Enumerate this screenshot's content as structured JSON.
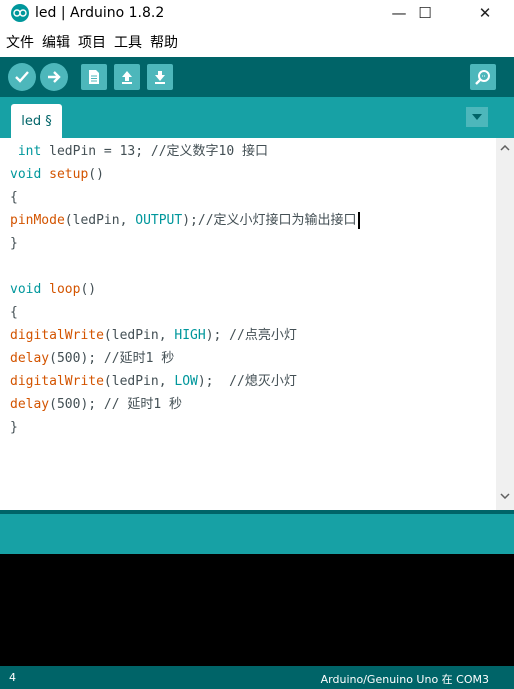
{
  "window": {
    "title": "led | Arduino 1.8.2",
    "minimize_symbol": "—",
    "maximize_symbol": "☐",
    "close_symbol": "✕"
  },
  "menu": [
    "文件",
    "编辑",
    "项目",
    "工具",
    "帮助"
  ],
  "toolbar": {
    "buttons": [
      {
        "name": "verify",
        "icon": "check-icon"
      },
      {
        "name": "upload",
        "icon": "arrow-right-icon"
      },
      {
        "name": "new",
        "icon": "document-icon"
      },
      {
        "name": "open",
        "icon": "arrow-up-icon"
      },
      {
        "name": "save",
        "icon": "arrow-down-icon"
      },
      {
        "name": "serial-monitor",
        "icon": "magnifier-icon"
      }
    ]
  },
  "tabs": [
    {
      "label": "led §"
    }
  ],
  "editor": {
    "lines": [
      [
        {
          "t": " "
        },
        {
          "t": "int",
          "c": "kw-type"
        },
        {
          "t": " ledPin = 13; //定义数字10 接口"
        }
      ],
      [
        {
          "t": "void",
          "c": "kw-type"
        },
        {
          "t": " "
        },
        {
          "t": "setup",
          "c": "kw-func"
        },
        {
          "t": "()"
        }
      ],
      [
        {
          "t": "{"
        }
      ],
      [
        {
          "t": "pinMode",
          "c": "kw-func"
        },
        {
          "t": "(ledPin, "
        },
        {
          "t": "OUTPUT",
          "c": "kw-const"
        },
        {
          "t": ");//定义小灯接口为输出接口"
        }
      ],
      [
        {
          "t": "}"
        }
      ],
      [],
      [
        {
          "t": "void",
          "c": "kw-type"
        },
        {
          "t": " "
        },
        {
          "t": "loop",
          "c": "kw-func"
        },
        {
          "t": "()"
        }
      ],
      [
        {
          "t": "{"
        }
      ],
      [
        {
          "t": "digitalWrite",
          "c": "kw-func"
        },
        {
          "t": "(ledPin, "
        },
        {
          "t": "HIGH",
          "c": "kw-const"
        },
        {
          "t": "); //点亮小灯"
        }
      ],
      [
        {
          "t": "delay",
          "c": "kw-func"
        },
        {
          "t": "(500); //延时1 秒"
        }
      ],
      [
        {
          "t": "digitalWrite",
          "c": "kw-func"
        },
        {
          "t": "(ledPin, "
        },
        {
          "t": "LOW",
          "c": "kw-const"
        },
        {
          "t": ");  //熄灭小灯"
        }
      ],
      [
        {
          "t": "delay",
          "c": "kw-func"
        },
        {
          "t": "(500); // 延时1 秒"
        }
      ],
      [
        {
          "t": "}"
        }
      ]
    ],
    "caret_line": 3
  },
  "status": {
    "line_number": "4",
    "board": "Arduino/Genuino Uno 在 COM3"
  },
  "colors": {
    "toolbar": "#006468",
    "tabbar": "#17a1a5",
    "button": "#4db7bb",
    "keyword_type": "#00979c",
    "keyword_func": "#d35400"
  }
}
